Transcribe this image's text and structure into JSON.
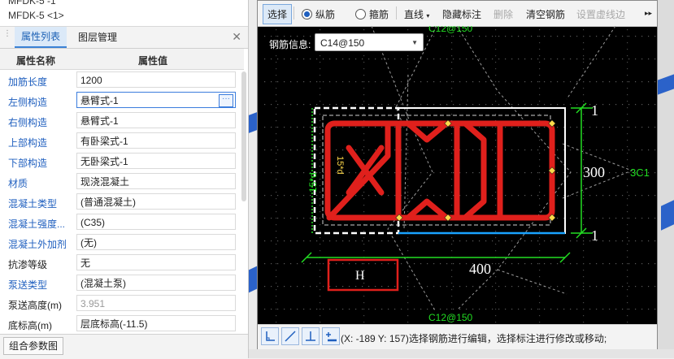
{
  "top_list": [
    "MFDK-5 <1>"
  ],
  "panel": {
    "tabs": [
      {
        "label": "属性列表",
        "active": true
      },
      {
        "label": "图层管理",
        "active": false
      }
    ],
    "columns": {
      "name": "属性名称",
      "value": "属性值"
    },
    "rows": [
      {
        "name": "加筋长度",
        "value": "1200",
        "link": true
      },
      {
        "name": "左侧构造",
        "value": "悬臂式-1",
        "link": true,
        "selected": true
      },
      {
        "name": "右侧构造",
        "value": "悬臂式-1",
        "link": true
      },
      {
        "name": "上部构造",
        "value": "有卧梁式-1",
        "link": true
      },
      {
        "name": "下部构造",
        "value": "无卧梁式-1",
        "link": true
      },
      {
        "name": "材质",
        "value": "现浇混凝土",
        "link": true
      },
      {
        "name": "混凝土类型",
        "value": "(普通混凝土)",
        "link": true
      },
      {
        "name": "混凝土强度...",
        "value": "(C35)",
        "link": true
      },
      {
        "name": "混凝土外加剂",
        "value": "(无)",
        "link": true
      },
      {
        "name": "抗渗等级",
        "value": "无",
        "link": false
      },
      {
        "name": "泵送类型",
        "value": "(混凝土泵)",
        "link": true
      },
      {
        "name": "泵送高度(m)",
        "value": "3.951",
        "link": false,
        "gray": true
      },
      {
        "name": "底标高(m)",
        "value": "层底标高(-11.5)",
        "link": false
      }
    ],
    "bottom_button": "组合参数图"
  },
  "toolbar": {
    "select": "选择",
    "radio_long": "纵筋",
    "radio_stirrup": "箍筋",
    "line": "直线",
    "hide_marks": "隐藏标注",
    "delete": "删除",
    "clear_rebar": "清空钢筋",
    "set_dashed": "设置虚线边",
    "more": "▸▸"
  },
  "rebar_info": {
    "label": "钢筋信息:",
    "value": "C14@150"
  },
  "drawing": {
    "top_label": "C12@150",
    "bottom_label": "C12@150",
    "dim_width": "400",
    "dim_height": "300",
    "dim_top": "1",
    "dim_bottom": "1",
    "side_label": "15*d",
    "inner_label": "15*d",
    "right_label": "3C1",
    "h_box": "H",
    "top_right_text": "ㄒㄒ/ ̄"
  },
  "status_text": "(X: -189 Y: 157)选择钢筋进行编辑，选择标注进行修改或移动;",
  "colors": {
    "rebar": "#e0201c",
    "dim": "#22dd22",
    "accent": "#1f5fbf"
  }
}
